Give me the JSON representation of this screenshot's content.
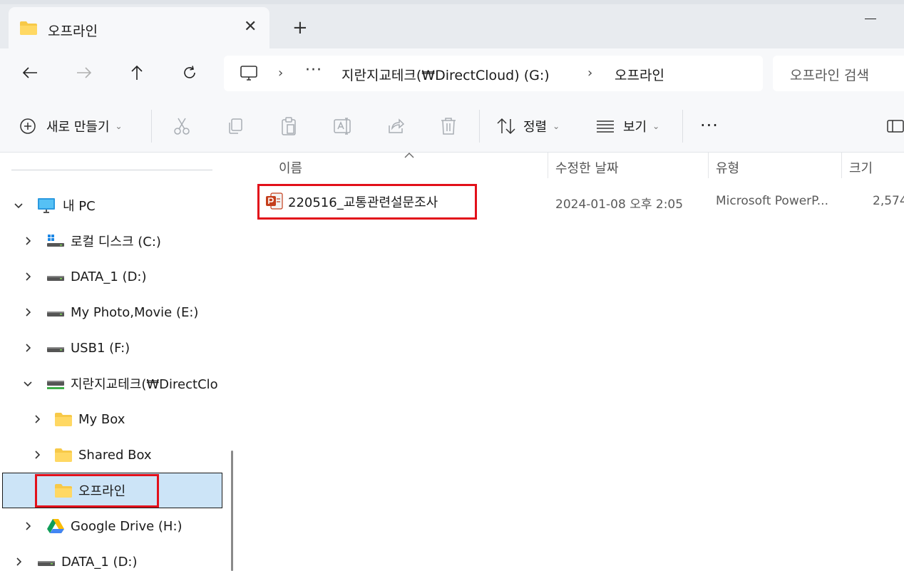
{
  "window": {
    "tab_title": "오프라인",
    "close_glyph": "✕",
    "new_tab_glyph": "+"
  },
  "nav": {
    "address": {
      "separator": "›",
      "overflow": "···",
      "drive": "지란지교테크(₩DirectCloud) (G:)",
      "folder": "오프라인"
    },
    "search_placeholder": "오프라인 검색"
  },
  "toolbar": {
    "new_label": "새로 만들기",
    "sort_label": "정렬",
    "view_label": "보기",
    "more_glyph": "···",
    "caret": "⌄"
  },
  "sidebar": {
    "items": [
      {
        "label": "내 PC",
        "icon": "monitor-icon",
        "expanded": true
      },
      {
        "label": "로컬 디스크 (C:)",
        "icon": "windows-drive-icon"
      },
      {
        "label": "DATA_1 (D:)",
        "icon": "drive-icon"
      },
      {
        "label": "My Photo,Movie (E:)",
        "icon": "drive-icon"
      },
      {
        "label": "USB1 (F:)",
        "icon": "drive-icon"
      },
      {
        "label": "지란지교테크(₩DirectClo",
        "icon": "network-drive-icon",
        "expanded": true
      },
      {
        "label": "My Box",
        "icon": "folder-icon"
      },
      {
        "label": "Shared Box",
        "icon": "folder-icon"
      },
      {
        "label": "오프라인",
        "icon": "folder-icon",
        "selected": true
      },
      {
        "label": "Google Drive (H:)",
        "icon": "google-drive-icon"
      },
      {
        "label": "DATA_1 (D:)",
        "icon": "drive-icon"
      }
    ]
  },
  "columns": {
    "name": "이름",
    "modified": "수정한 날짜",
    "type": "유형",
    "size": "크기"
  },
  "files": [
    {
      "name": "220516_교통관련설문조사",
      "modified": "2024-01-08 오후 2:05",
      "type": "Microsoft PowerP...",
      "size": "2,574",
      "icon": "powerpoint-icon"
    }
  ],
  "colors": {
    "highlight": "#e2101a",
    "selection": "#cce4f7",
    "folder": "#f7c948",
    "powerpoint": "#c43e1c"
  }
}
